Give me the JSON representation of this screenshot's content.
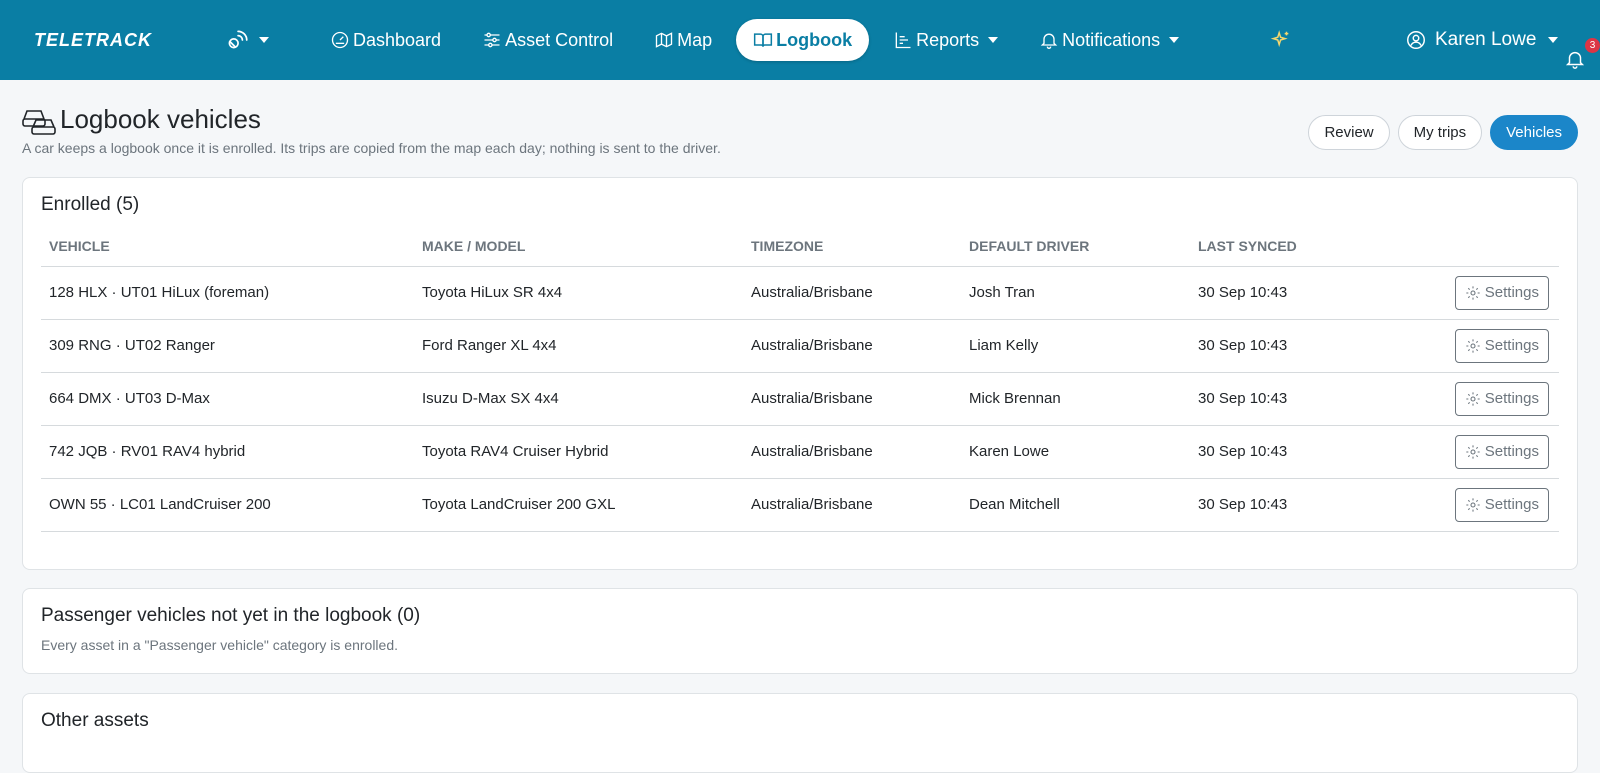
{
  "nav": {
    "brand": "TELETRACK",
    "items": [
      {
        "label": "Dashboard"
      },
      {
        "label": "Asset Control"
      },
      {
        "label": "Map"
      },
      {
        "label": "Logbook"
      },
      {
        "label": "Reports"
      },
      {
        "label": "Notifications"
      }
    ],
    "notification_count": "3",
    "user_name": "Karen Lowe",
    "icons": [
      "signal-icon",
      "dashboard-icon",
      "sliders-icon",
      "map-icon",
      "book-icon",
      "chart-icon",
      "bell-icon",
      "sparkles-icon",
      "user-icon"
    ]
  },
  "header": {
    "title": "Logbook vehicles",
    "subtitle": "A car keeps a logbook once it is enrolled. Its trips are copied from the map each day; nothing is sent to the driver."
  },
  "view_pills": [
    {
      "label": "Review",
      "active": false
    },
    {
      "label": "My trips",
      "active": false
    },
    {
      "label": "Vehicles",
      "active": true
    }
  ],
  "enrolled": {
    "title": "Enrolled (5)",
    "columns": [
      "VEHICLE",
      "MAKE / MODEL",
      "TIMEZONE",
      "DEFAULT DRIVER",
      "LAST SYNCED"
    ],
    "action_label": "Settings",
    "rows": [
      {
        "vehicle": "128 HLX · UT01 HiLux (foreman)",
        "model": "Toyota HiLux SR 4x4",
        "timezone": "Australia/Brisbane",
        "driver": "Josh Tran",
        "synced": "30 Sep 10:43"
      },
      {
        "vehicle": "309 RNG · UT02 Ranger",
        "model": "Ford Ranger XL 4x4",
        "timezone": "Australia/Brisbane",
        "driver": "Liam Kelly",
        "synced": "30 Sep 10:43"
      },
      {
        "vehicle": "664 DMX · UT03 D-Max",
        "model": "Isuzu D-Max SX 4x4",
        "timezone": "Australia/Brisbane",
        "driver": "Mick Brennan",
        "synced": "30 Sep 10:43"
      },
      {
        "vehicle": "742 JQB · RV01 RAV4 hybrid",
        "model": "Toyota RAV4 Cruiser Hybrid",
        "timezone": "Australia/Brisbane",
        "driver": "Karen Lowe",
        "synced": "30 Sep 10:43"
      },
      {
        "vehicle": "OWN 55 · LC01 LandCruiser 200",
        "model": "Toyota LandCruiser 200 GXL",
        "timezone": "Australia/Brisbane",
        "driver": "Dean Mitchell",
        "synced": "30 Sep 10:43"
      }
    ]
  },
  "not_enrolled": {
    "title": "Passenger vehicles not yet in the logbook (0)",
    "note": "Every asset in a \"Passenger vehicle\" category is enrolled."
  },
  "other_assets": {
    "title": "Other assets"
  },
  "colors": {
    "navbar": "#0a7ea4",
    "active_pill": "#1b86c9",
    "badge": "#dc3545",
    "sparkle": "#f5d76e"
  }
}
